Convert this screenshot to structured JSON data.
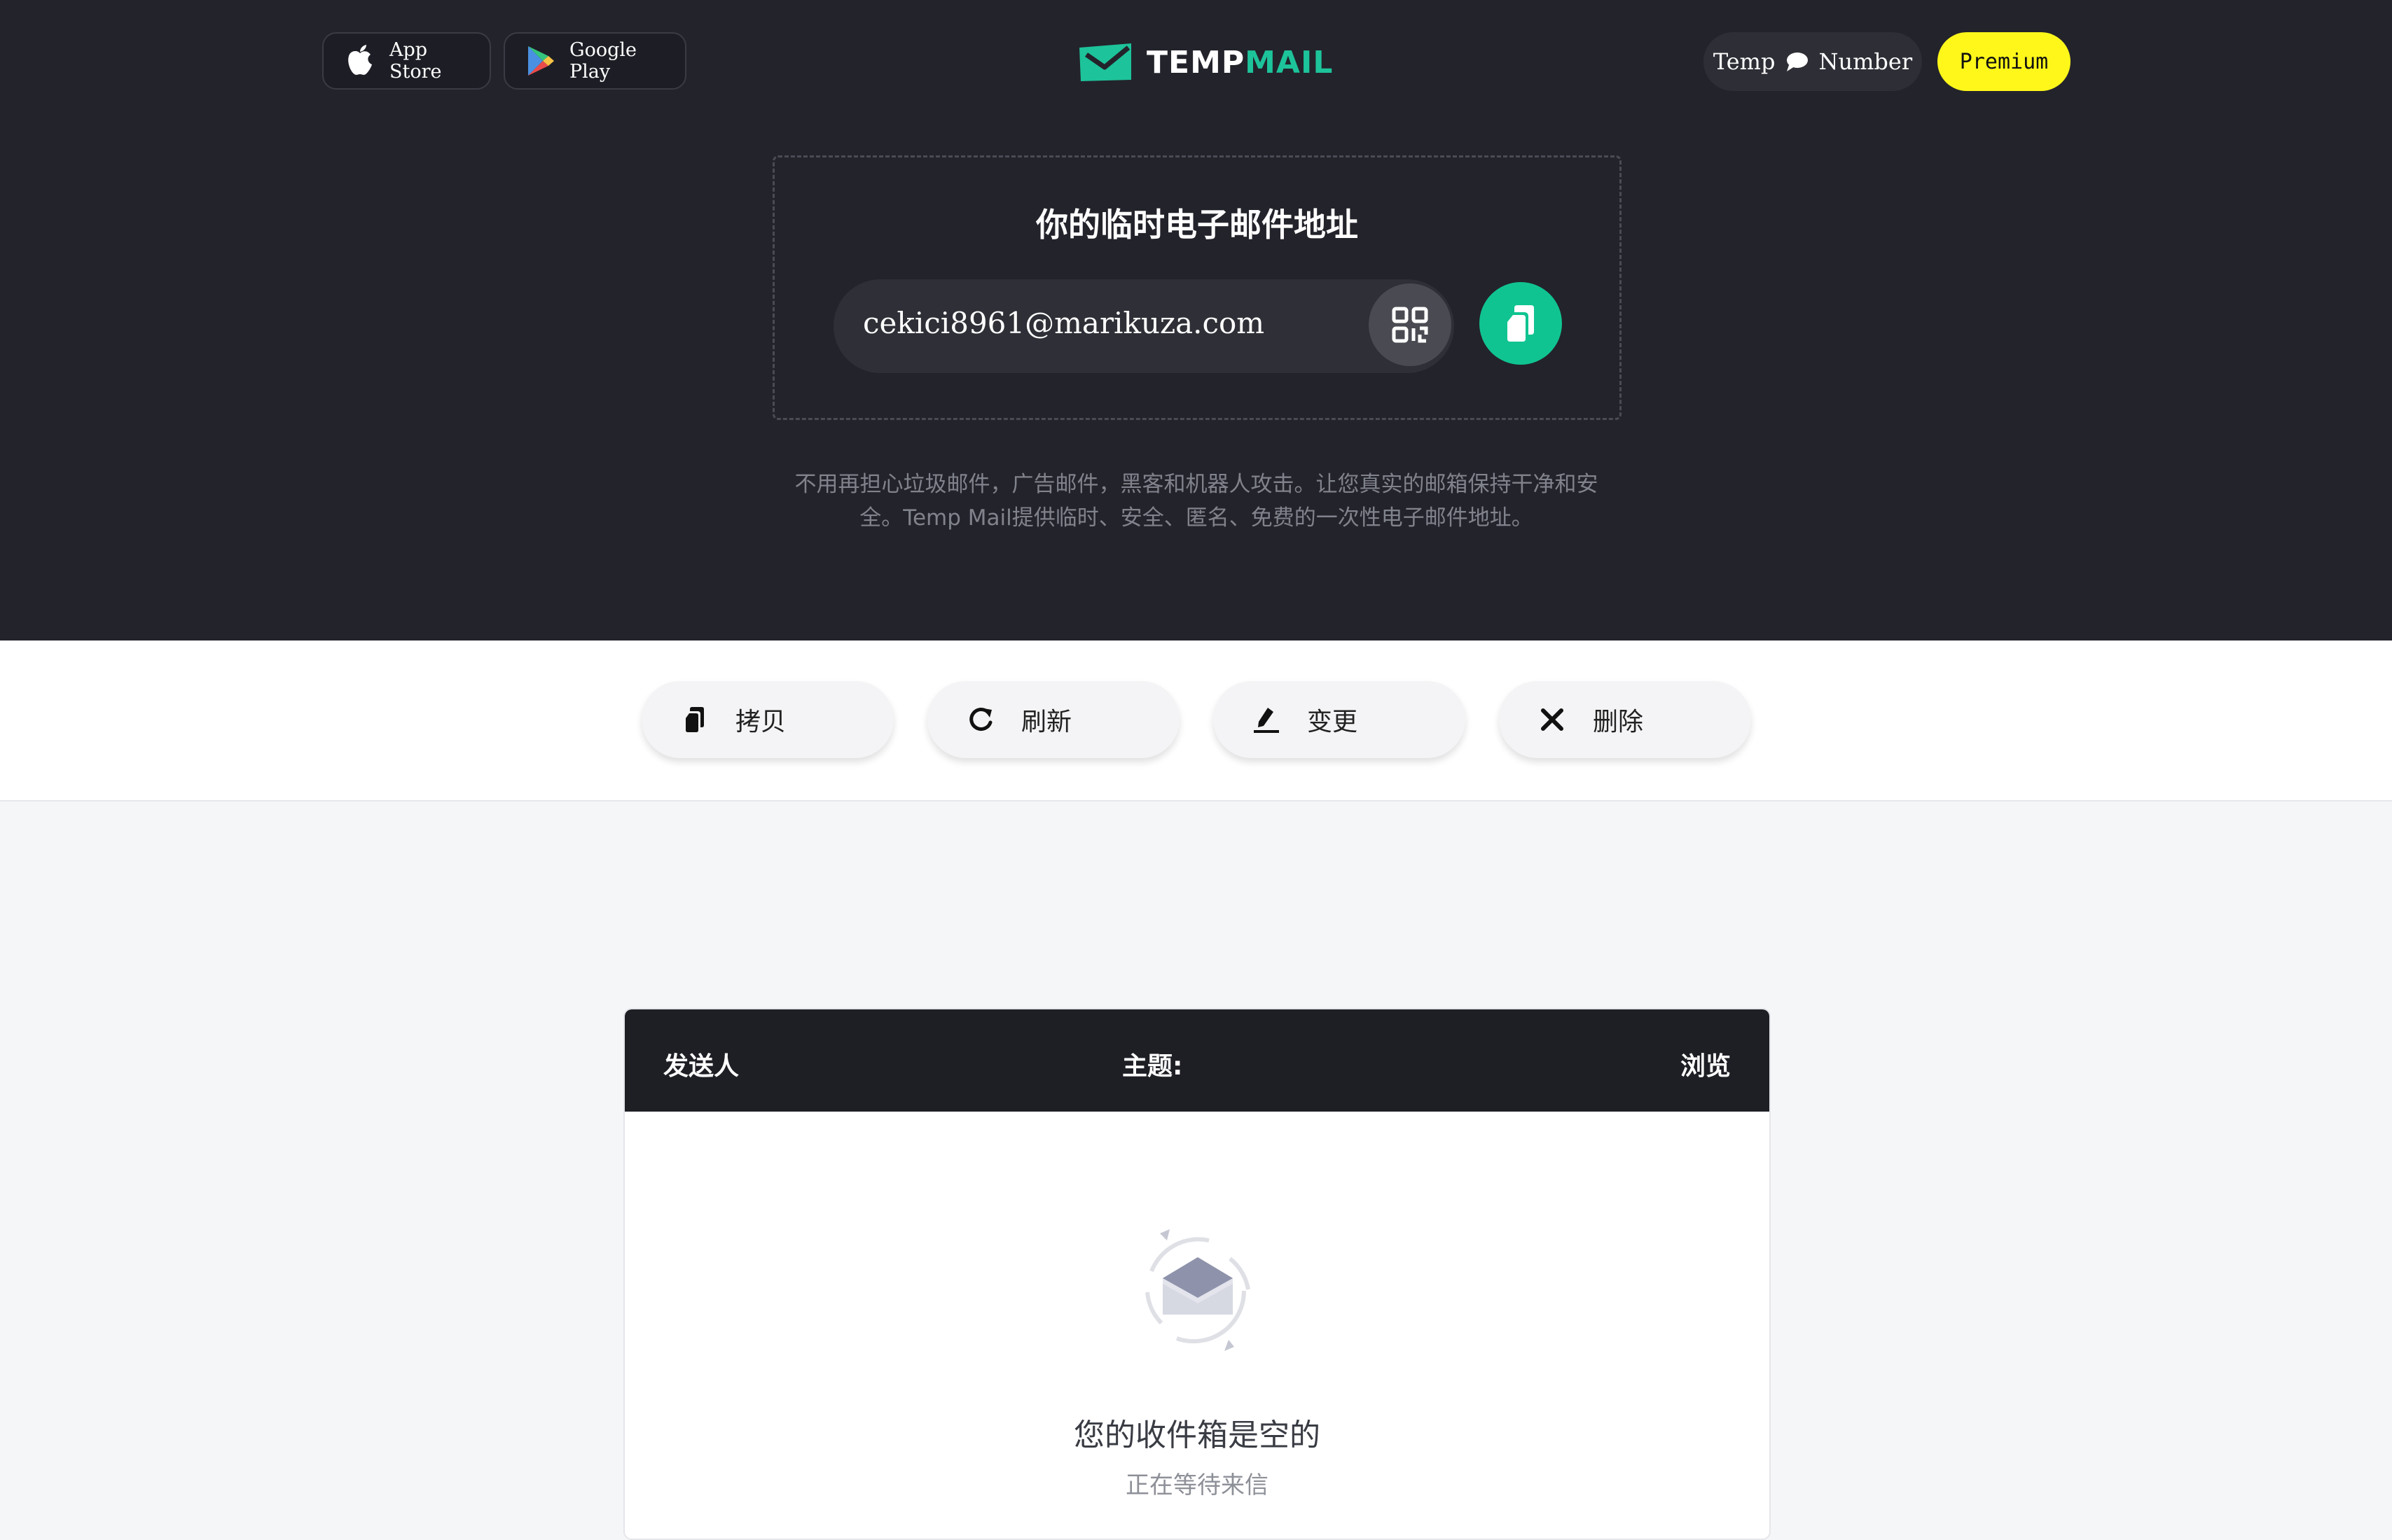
{
  "header": {
    "app_store_label": "App Store",
    "google_play_label": "Google Play",
    "logo_prefix": "TEMP",
    "logo_suffix": "MAIL",
    "temp_number_left": "Temp",
    "temp_number_right": "Number",
    "premium_label": "Premium"
  },
  "email": {
    "title": "你的临时电子邮件地址",
    "address": "cekici8961@marikuza.com"
  },
  "description": "不用再担心垃圾邮件，广告邮件，黑客和机器人攻击。让您真实的邮箱保持干净和安全。Temp Mail提供临时、安全、匿名、免费的一次性电子邮件地址。",
  "actions": [
    {
      "label": "拷贝",
      "icon": "copy-icon"
    },
    {
      "label": "刷新",
      "icon": "refresh-icon"
    },
    {
      "label": "变更",
      "icon": "edit-icon"
    },
    {
      "label": "删除",
      "icon": "close-icon"
    }
  ],
  "inbox": {
    "col_sender": "发送人",
    "col_subject": "主题:",
    "col_view": "浏览",
    "empty_title": "您的收件箱是空的",
    "empty_subtitle": "正在等待来信"
  },
  "colors": {
    "hero_bg": "#23232b",
    "accent_green": "#10c491",
    "premium_yellow": "#fff71a"
  }
}
